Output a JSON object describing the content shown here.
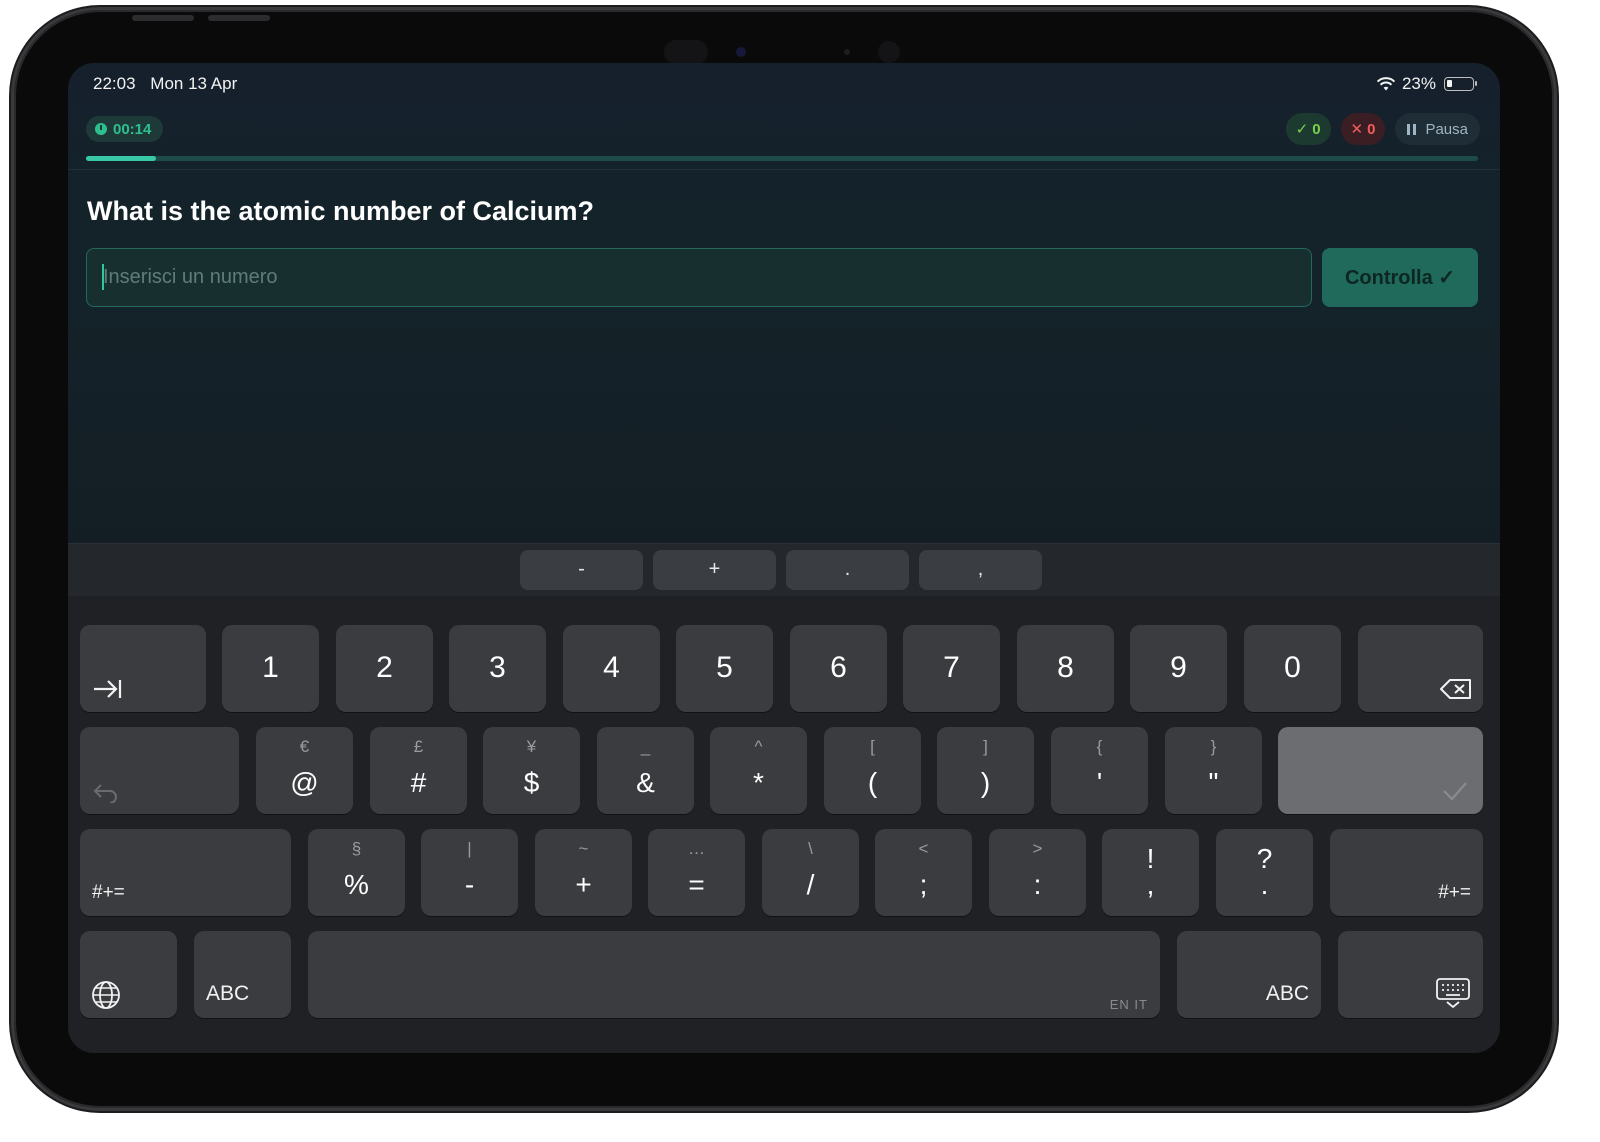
{
  "status_bar": {
    "time": "22:03",
    "date": "Mon 13 Apr",
    "battery_percent": "23%",
    "battery_level": 0.23
  },
  "quiz": {
    "timer": "00:14",
    "correct_count": "0",
    "wrong_count": "0",
    "correct_symbol": "✓",
    "wrong_symbol": "✕",
    "pause_label": "Pausa",
    "progress": 0.05,
    "question": "What is the atomic number of Calcium?",
    "answer": {
      "value": "",
      "placeholder": "Inserisci un numero"
    },
    "check_label": "Controlla ✓"
  },
  "accessory_keys": [
    "-",
    "+",
    ".",
    ","
  ],
  "keyboard": {
    "row1": [
      "1",
      "2",
      "3",
      "4",
      "5",
      "6",
      "7",
      "8",
      "9",
      "0"
    ],
    "row2": [
      {
        "main": "@",
        "alt": "€"
      },
      {
        "main": "#",
        "alt": "£"
      },
      {
        "main": "$",
        "alt": "¥"
      },
      {
        "main": "&",
        "alt": "_"
      },
      {
        "main": "*",
        "alt": "^"
      },
      {
        "main": "(",
        "alt": "["
      },
      {
        "main": ")",
        "alt": "]"
      },
      {
        "main": "'",
        "alt": "{"
      },
      {
        "main": "\"",
        "alt": "}"
      }
    ],
    "row3": [
      {
        "main": "%",
        "alt": "§"
      },
      {
        "main": "-",
        "alt": "|"
      },
      {
        "main": "+",
        "alt": "~"
      },
      {
        "main": "=",
        "alt": "…"
      },
      {
        "main": "/",
        "alt": "\\"
      },
      {
        "main": ";",
        "alt": "<"
      },
      {
        "main": ":",
        "alt": ">"
      },
      {
        "main": ",",
        "alt": "!"
      },
      {
        "main": ".",
        "alt": "?"
      }
    ],
    "symbols_toggle_label": "#+=",
    "abc_label": "ABC",
    "space_language": "EN IT",
    "tab_icon": "tab-icon",
    "delete_icon": "delete-icon",
    "undo_icon": "undo-icon",
    "return_icon": "checkmark-icon",
    "globe_icon": "globe-icon",
    "dismiss_icon": "keyboard-dismiss-icon"
  },
  "colors": {
    "accent": "#2fbf8f",
    "correct": "#7ad14b",
    "wrong": "#f25c5c",
    "progress": "#38c8a8"
  }
}
